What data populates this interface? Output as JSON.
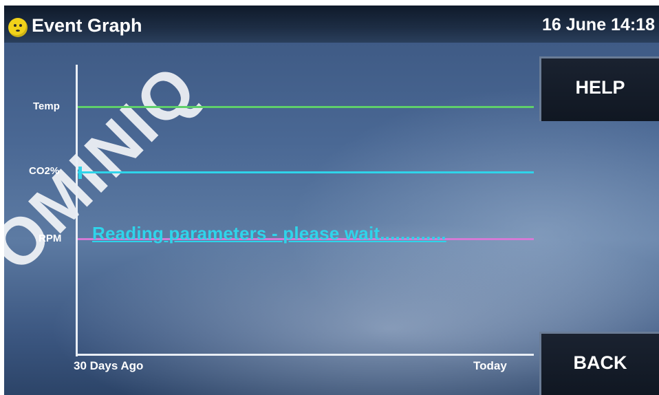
{
  "header": {
    "title": "Event Graph",
    "datetime": "16 June 14:18"
  },
  "graph": {
    "y_labels": {
      "temp": "Temp",
      "co2": "CO2%",
      "rpm": "RPM"
    },
    "x_labels": {
      "start": "30 Days Ago",
      "end": "Today"
    },
    "trace_colors": {
      "temp": "#5fd06a",
      "co2": "#2fd4ea",
      "rpm": "#d57ad6"
    },
    "status_message": "Reading parameters - please wait............."
  },
  "buttons": {
    "help": "HELP",
    "back": "BACK"
  },
  "watermark": "OMINIQ"
}
